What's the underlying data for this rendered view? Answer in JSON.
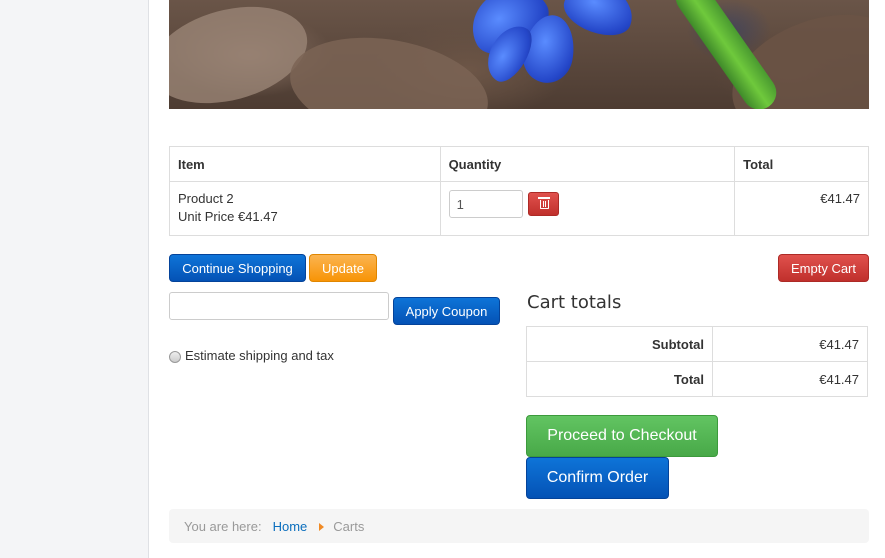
{
  "cart": {
    "headers": {
      "item": "Item",
      "quantity": "Quantity",
      "total": "Total"
    },
    "rows": [
      {
        "name": "Product 2",
        "unit_price": "Unit Price €41.47",
        "quantity": "1",
        "total": "€41.47"
      }
    ]
  },
  "actions": {
    "continue_shopping": "Continue Shopping",
    "update": "Update",
    "empty_cart": "Empty Cart",
    "apply_coupon": "Apply Coupon",
    "coupon_placeholder": ""
  },
  "shipping": {
    "estimate_label": "Estimate shipping and tax"
  },
  "totals": {
    "title": "Cart totals",
    "rows": [
      {
        "label": "Subtotal",
        "value": "€41.47"
      },
      {
        "label": "Total",
        "value": "€41.47"
      }
    ]
  },
  "checkout": {
    "proceed": "Proceed to Checkout",
    "confirm": "Confirm Order"
  },
  "breadcrumb": {
    "prefix": "You are here:",
    "home": "Home",
    "current": "Carts"
  },
  "colors": {
    "primary_blue": "#0452b5",
    "warning_orange": "#f89406",
    "danger_red": "#c0302c",
    "success_green": "#48a948",
    "link": "#0a6ebd"
  },
  "icons": {
    "delete": "trash-icon",
    "breadcrumb_separator": "caret-right-icon"
  }
}
